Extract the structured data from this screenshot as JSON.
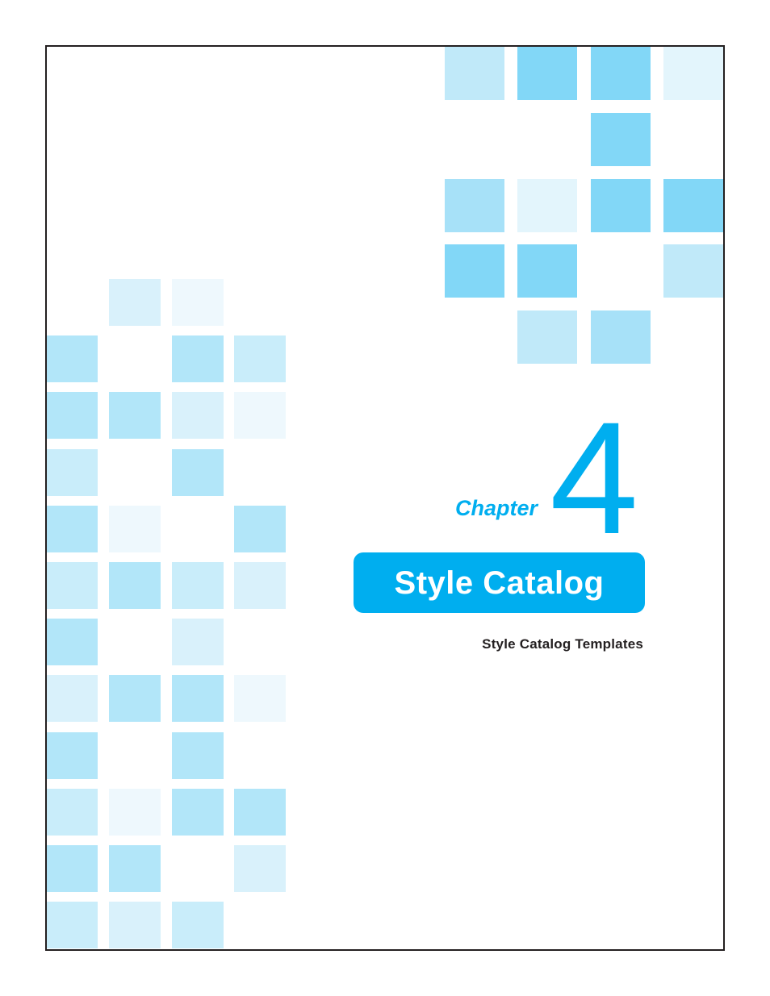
{
  "chapter": {
    "label": "Chapter",
    "number": "4",
    "title": "Style Catalog",
    "subtitle": "Style Catalog Templates"
  },
  "colors": {
    "accent": "#00aeef",
    "frame": "#231f20",
    "subtitle_text": "#231f20",
    "title_text": "#ffffff"
  },
  "decoration": {
    "top_right_palette": {
      "m": "#82d7f7",
      "h": "#a7e1f8",
      "l": "#c0e9f9",
      "v": "#e3f5fc"
    },
    "top_right_grid": [
      [
        "l",
        "m",
        "m",
        "v"
      ],
      [
        "",
        "",
        "m",
        ""
      ],
      [
        "h",
        "v",
        "m",
        "m"
      ],
      [
        "m",
        "m",
        "",
        "l"
      ],
      [
        "",
        "l",
        "h",
        ""
      ]
    ],
    "left_palette": {
      "a": "#b2e6f9",
      "b": "#c9edfa",
      "c": "#d9f1fb",
      "d": "#eef8fd"
    },
    "left_grid": [
      [
        "",
        "c",
        "d",
        ""
      ],
      [
        "a",
        "",
        "a",
        "b"
      ],
      [
        "a",
        "a",
        "c",
        "d"
      ],
      [
        "b",
        "",
        "a",
        ""
      ],
      [
        "a",
        "d",
        "",
        "a"
      ],
      [
        "b",
        "a",
        "b",
        "c"
      ],
      [
        "a",
        "",
        "c",
        ""
      ],
      [
        "c",
        "a",
        "a",
        "d"
      ],
      [
        "a",
        "",
        "a",
        ""
      ],
      [
        "b",
        "d",
        "a",
        "a"
      ],
      [
        "a",
        "a",
        "",
        "c"
      ],
      [
        "b",
        "c",
        "b",
        ""
      ]
    ]
  }
}
